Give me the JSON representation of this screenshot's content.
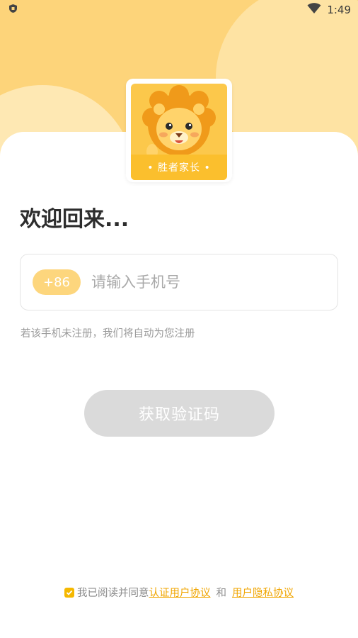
{
  "status_bar": {
    "time": "1:49"
  },
  "logo": {
    "ribbon_text": "• 胜者家长 •"
  },
  "heading": "欢迎回来...",
  "phone": {
    "country_code": "+86",
    "placeholder": "请输入手机号"
  },
  "hint": "若该手机未注册，我们将自动为您注册",
  "get_code_button": "获取验证码",
  "agreement": {
    "prefix": "我已阅读并同意",
    "link1": "认证用户协议",
    "and": "和",
    "link2": "用户隐私协议",
    "checked": true
  },
  "colors": {
    "accent": "#fdd47a",
    "button_disabled": "#dadada",
    "link": "#f0a500"
  }
}
